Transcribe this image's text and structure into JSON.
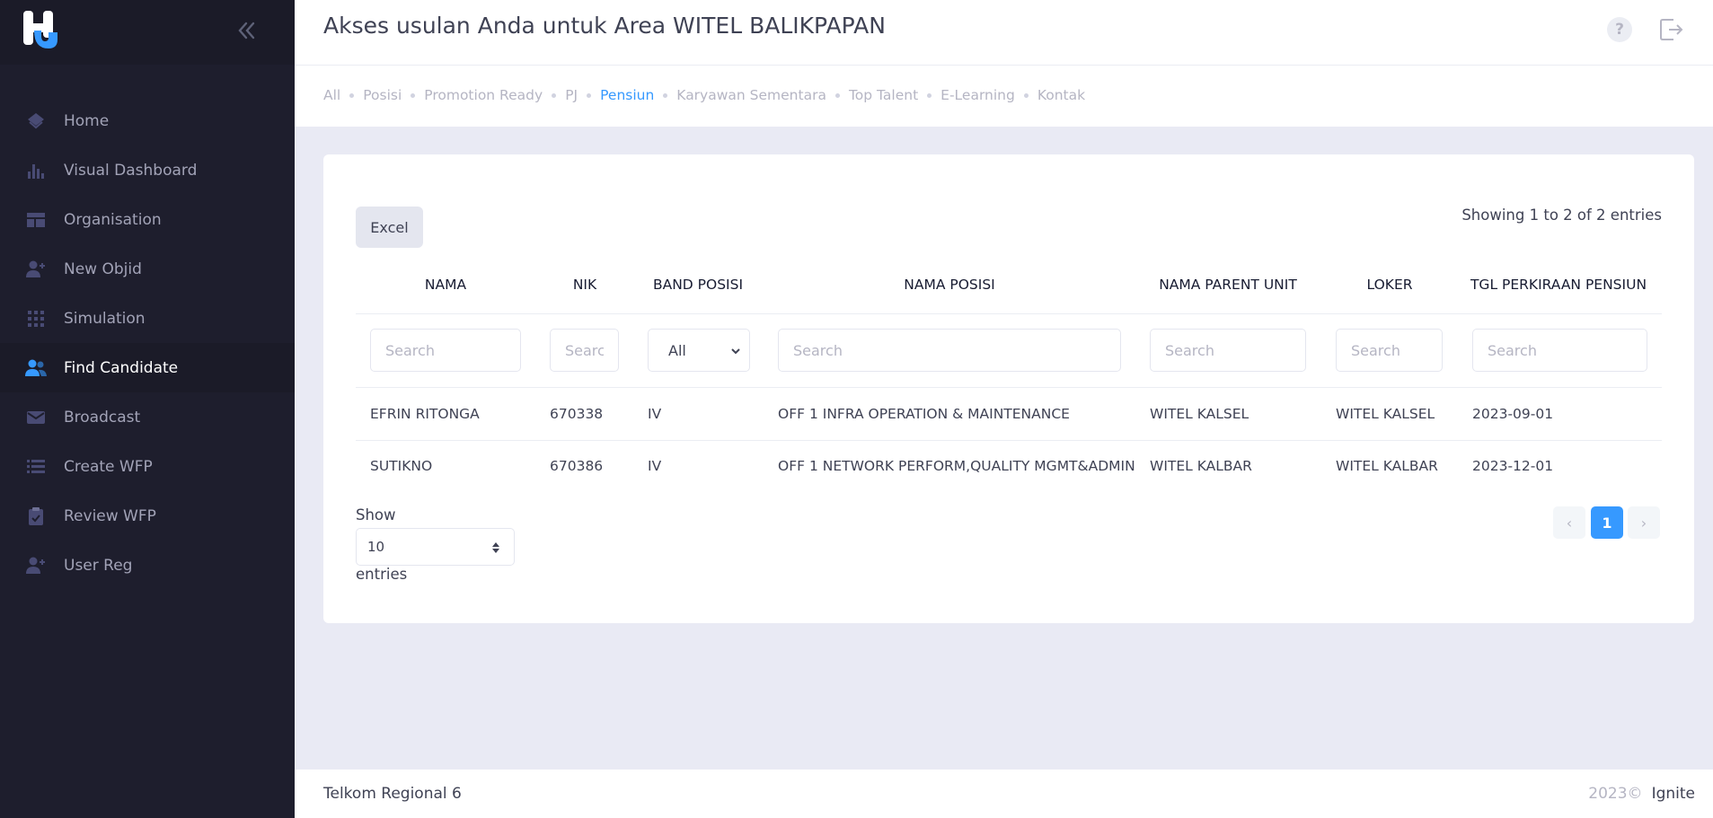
{
  "sidebar": {
    "logo": "hire-logo",
    "items": [
      {
        "label": "Home",
        "icon": "home-icon"
      },
      {
        "label": "Visual Dashboard",
        "icon": "bar-chart-icon"
      },
      {
        "label": "Organisation",
        "icon": "layout-icon"
      },
      {
        "label": "New Objid",
        "icon": "add-user-icon"
      },
      {
        "label": "Simulation",
        "icon": "grid-dots-icon"
      },
      {
        "label": "Find Candidate",
        "icon": "users-icon",
        "active": true
      },
      {
        "label": "Broadcast",
        "icon": "mail-icon"
      },
      {
        "label": "Create WFP",
        "icon": "list-icon"
      },
      {
        "label": "Review WFP",
        "icon": "clipboard-check-icon"
      },
      {
        "label": "User Reg",
        "icon": "add-user-icon"
      }
    ]
  },
  "header": {
    "title": "Akses usulan Anda untuk Area WITEL BALIKPAPAN",
    "help_label": "?"
  },
  "tabs": [
    {
      "label": "All"
    },
    {
      "label": "Posisi"
    },
    {
      "label": "Promotion Ready"
    },
    {
      "label": "PJ"
    },
    {
      "label": "Pensiun",
      "active": true
    },
    {
      "label": "Karyawan Sementara"
    },
    {
      "label": "Top Talent"
    },
    {
      "label": "E-Learning"
    },
    {
      "label": "Kontak"
    }
  ],
  "table": {
    "excel_label": "Excel",
    "info": "Showing 1 to 2 of 2 entries",
    "columns": [
      "NAMA",
      "NIK",
      "BAND POSISI",
      "NAMA POSISI",
      "NAMA PARENT UNIT",
      "LOKER",
      "TGL PERKIRAAN PENSIUN"
    ],
    "filters": {
      "placeholder": "Search",
      "band_value": "All"
    },
    "rows": [
      [
        "EFRIN RITONGA",
        "670338",
        "IV",
        "OFF 1 INFRA OPERATION & MAINTENANCE",
        "WITEL KALSEL",
        "WITEL KALSEL",
        "2023-09-01"
      ],
      [
        "SUTIKNO",
        "670386",
        "IV",
        "OFF 1 NETWORK PERFORM,QUALITY MGMT&ADMIN",
        "WITEL KALBAR",
        "WITEL KALBAR",
        "2023-12-01"
      ]
    ],
    "show_label": "Show",
    "page_length": "10",
    "entries_label": "entries",
    "current_page": "1",
    "prev_label": "‹",
    "next_label": "›"
  },
  "footer": {
    "left": "Telkom Regional 6",
    "year": "2023©",
    "brand": "Ignite"
  },
  "colors": {
    "sidebar_bg": "#1e1e2d",
    "accent": "#3699ff",
    "page_bg": "#e9eaf4"
  }
}
